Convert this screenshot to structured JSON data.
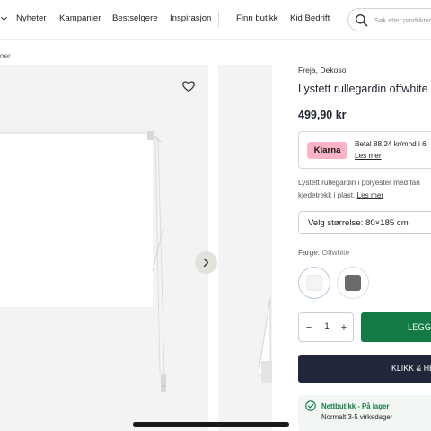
{
  "nav": {
    "items": [
      {
        "label": "Nyheter",
        "id": "nyheter"
      },
      {
        "label": "Kampanjer",
        "id": "kampanjer"
      },
      {
        "label": "Bestselgere",
        "id": "bestselgere"
      },
      {
        "label": "Inspirasjon",
        "id": "inspirasjon"
      },
      {
        "label": "Finn butikk",
        "id": "finn-butikk"
      },
      {
        "label": "Kid Bedrift",
        "id": "kid-bedrift"
      }
    ],
    "search_placeholder": "Søk etter produkter"
  },
  "breadcrumb": "iner",
  "product": {
    "brand": "Freja, Dekosol",
    "title": "Lystett rullegardin offwhite",
    "price": "499,90 kr",
    "klarna": {
      "logo_text": "Klarna",
      "text": "Betal 88,24 kr/mnd i 6",
      "link": "Les mer"
    },
    "description_line1": "Lystett rullegardin i polyester med fan",
    "description_line2": "kjedetrekk i plast.",
    "description_link": "Les mer",
    "size_select": "Velg størrelse: 80×185 cm",
    "color_label": "Farge:",
    "color_value": "Offwhite",
    "swatches": [
      {
        "name": "Offwhite",
        "color": "#f4f4f4",
        "selected": true
      },
      {
        "name": "Grå",
        "color": "#6b6a6c",
        "selected": false
      }
    ],
    "quantity": "1",
    "add_to_cart": "LEGG",
    "click_collect": "KLIKK & HE",
    "stock": {
      "status": "Nettbutikk - På lager",
      "delivery": "Normalt 3-5 virkedager"
    }
  },
  "colors": {
    "accent_green": "#137a45",
    "dark_button": "#22263a",
    "klarna_pink": "#ffb3c7",
    "gallery_bg": "#f3f3f3"
  }
}
